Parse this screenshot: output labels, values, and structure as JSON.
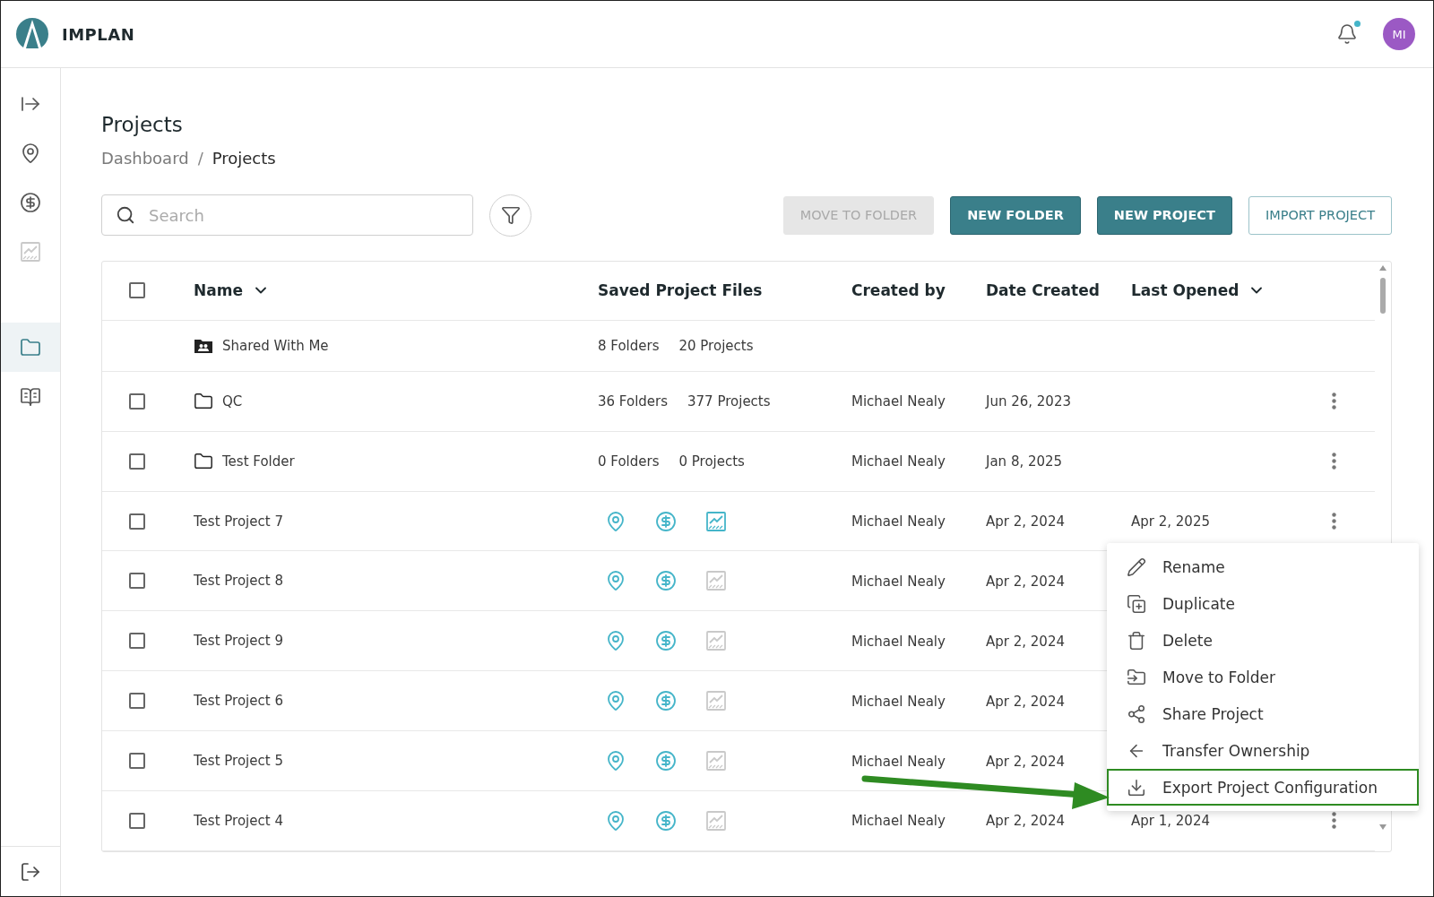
{
  "app": {
    "name": "IMPLAN"
  },
  "header": {
    "notification_dot": true,
    "avatar": "MI"
  },
  "sidebar": {
    "items": [
      {
        "kind": "expand",
        "selected": false,
        "disabled": false
      },
      {
        "kind": "regions",
        "selected": false,
        "disabled": false
      },
      {
        "kind": "economics",
        "selected": false,
        "disabled": false
      },
      {
        "kind": "chart",
        "selected": false,
        "disabled": true
      },
      {
        "kind": "projects",
        "selected": true,
        "disabled": false
      },
      {
        "kind": "guide",
        "selected": false,
        "disabled": false
      }
    ],
    "footer": {
      "kind": "logout"
    }
  },
  "page": {
    "title": "Projects",
    "breadcrumb_separator": "/",
    "breadcrumb": [
      {
        "label": "Dashboard",
        "current": false
      },
      {
        "label": "Projects",
        "current": true
      }
    ]
  },
  "search": {
    "placeholder": "Search"
  },
  "buttons": [
    {
      "label": "MOVE TO FOLDER",
      "kind": "primary",
      "disabled": true
    },
    {
      "label": "NEW FOLDER",
      "kind": "primary",
      "disabled": false
    },
    {
      "label": "NEW PROJECT",
      "kind": "primary",
      "disabled": false
    },
    {
      "label": "IMPORT PROJECT",
      "kind": "outline",
      "disabled": false
    }
  ],
  "table": {
    "select_all": {
      "checked": false
    },
    "columns": [
      {
        "label": "Name",
        "sortable": true
      },
      {
        "label": "Saved Project Files"
      },
      {
        "label": "Created by"
      },
      {
        "label": "Date Created"
      },
      {
        "label": "Last Opened",
        "sortable": true
      }
    ],
    "rows": [
      {
        "kind": "shared",
        "name": "Shared With Me",
        "folders": "8 Folders",
        "projects": "20 Projects"
      },
      {
        "kind": "folder",
        "checked": false,
        "name": "QC",
        "folders": "36 Folders",
        "projects": "377 Projects",
        "created_by": "Michael Nealy",
        "date_created": "Jun 26, 2023",
        "more_button": true
      },
      {
        "kind": "folder",
        "checked": false,
        "name": "Test Folder",
        "folders": "0 Folders",
        "projects": "0 Projects",
        "created_by": "Michael Nealy",
        "date_created": "Jan 8, 2025",
        "more_button": true
      },
      {
        "kind": "project",
        "checked": false,
        "name": "Test Project 7",
        "files": [
          {
            "kind": "region",
            "available": true
          },
          {
            "kind": "economic",
            "available": true
          },
          {
            "kind": "chart",
            "available": true
          }
        ],
        "created_by": "Michael Nealy",
        "date_created": "Apr 2, 2024",
        "last_opened": "Apr 2, 2025",
        "more_button": true
      },
      {
        "kind": "project",
        "checked": false,
        "name": "Test Project 8",
        "files": [
          {
            "kind": "region",
            "available": true
          },
          {
            "kind": "economic",
            "available": true
          },
          {
            "kind": "chart",
            "available": false
          }
        ],
        "created_by": "Michael Nealy",
        "date_created": "Apr 2, 2024",
        "more_button": false
      },
      {
        "kind": "project",
        "checked": false,
        "name": "Test Project 9",
        "files": [
          {
            "kind": "region",
            "available": true
          },
          {
            "kind": "economic",
            "available": true
          },
          {
            "kind": "chart",
            "available": false
          }
        ],
        "created_by": "Michael Nealy",
        "date_created": "Apr 2, 2024",
        "more_button": false
      },
      {
        "kind": "project",
        "checked": false,
        "name": "Test Project 6",
        "files": [
          {
            "kind": "region",
            "available": true
          },
          {
            "kind": "economic",
            "available": true
          },
          {
            "kind": "chart",
            "available": false
          }
        ],
        "created_by": "Michael Nealy",
        "date_created": "Apr 2, 2024",
        "more_button": false
      },
      {
        "kind": "project",
        "checked": false,
        "name": "Test Project 5",
        "files": [
          {
            "kind": "region",
            "available": true
          },
          {
            "kind": "economic",
            "available": true
          },
          {
            "kind": "chart",
            "available": false
          }
        ],
        "created_by": "Michael Nealy",
        "date_created": "Apr 2, 2024",
        "more_button": false
      },
      {
        "kind": "project",
        "checked": false,
        "name": "Test Project 4",
        "files": [
          {
            "kind": "region",
            "available": true
          },
          {
            "kind": "economic",
            "available": true
          },
          {
            "kind": "chart",
            "available": false
          }
        ],
        "created_by": "Michael Nealy",
        "date_created": "Apr 2, 2024",
        "last_opened": "Apr 1, 2024",
        "more_button": true
      }
    ]
  },
  "context_menu": {
    "items": [
      {
        "kind": "rename",
        "label": "Rename",
        "highlighted": false
      },
      {
        "kind": "duplicate",
        "label": "Duplicate",
        "highlighted": false
      },
      {
        "kind": "delete",
        "label": "Delete",
        "highlighted": false
      },
      {
        "kind": "move",
        "label": "Move to Folder",
        "highlighted": false
      },
      {
        "kind": "share",
        "label": "Share Project",
        "highlighted": false
      },
      {
        "kind": "transfer",
        "label": "Transfer Ownership",
        "highlighted": false
      },
      {
        "kind": "export",
        "label": "Export Project Configuration",
        "highlighted": true
      }
    ]
  }
}
